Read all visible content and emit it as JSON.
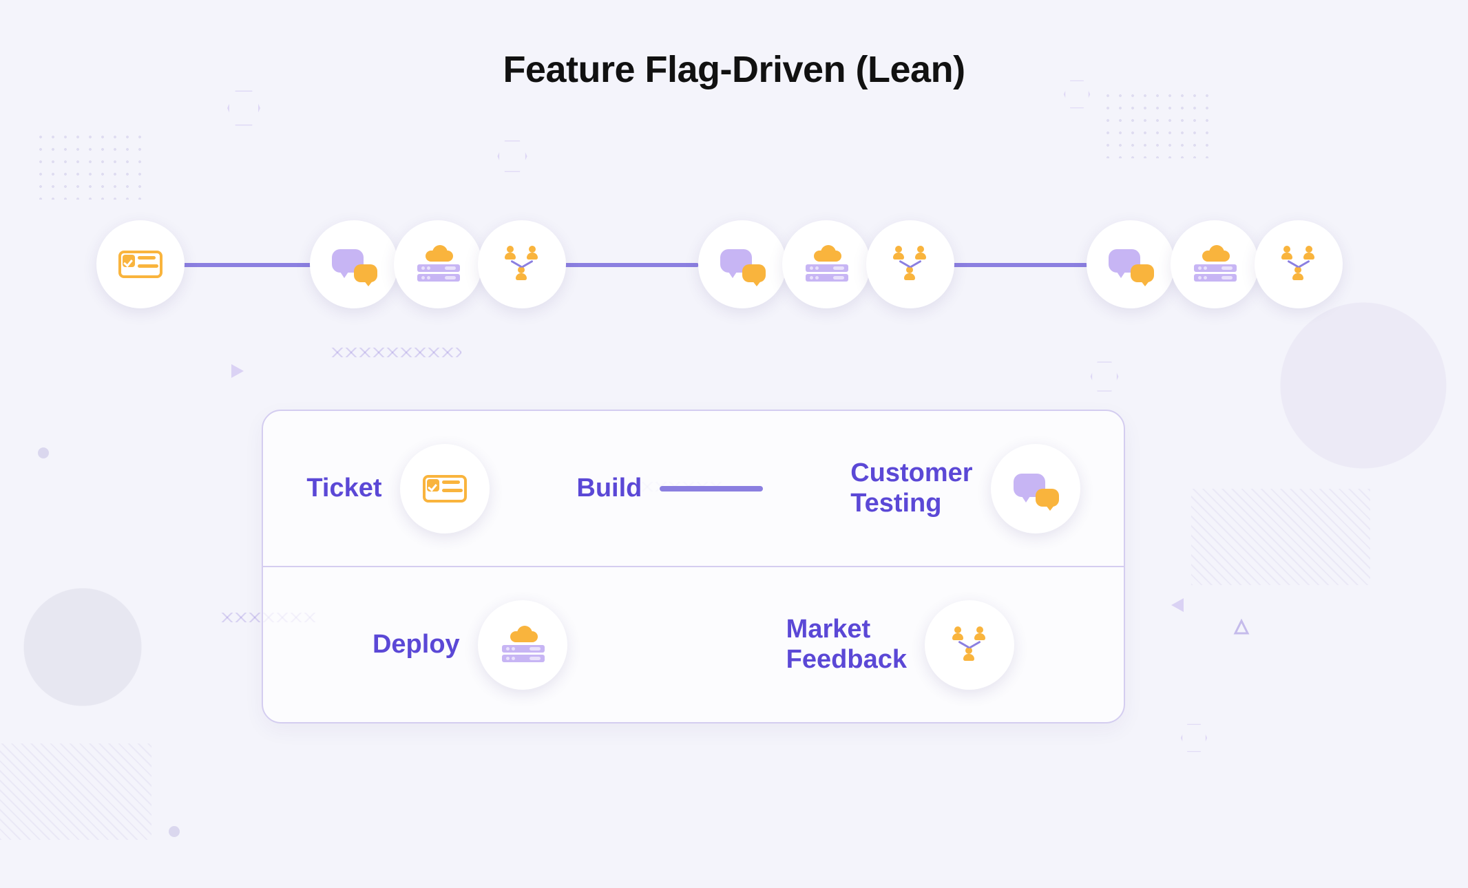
{
  "title": "Feature Flag-Driven (Lean)",
  "flow": {
    "start": {
      "icon": "ticket"
    },
    "groups": [
      {
        "steps": [
          {
            "icon": "chat"
          },
          {
            "icon": "deploy"
          },
          {
            "icon": "market"
          }
        ]
      },
      {
        "steps": [
          {
            "icon": "chat"
          },
          {
            "icon": "deploy"
          },
          {
            "icon": "market"
          }
        ]
      },
      {
        "steps": [
          {
            "icon": "chat"
          },
          {
            "icon": "deploy"
          },
          {
            "icon": "market"
          }
        ]
      }
    ]
  },
  "legend": {
    "row1": [
      {
        "label": "Ticket",
        "icon": "ticket"
      },
      {
        "label": "Build",
        "icon": "line"
      },
      {
        "label": "Customer\nTesting",
        "icon": "chat"
      }
    ],
    "row2": [
      {
        "label": "Deploy",
        "icon": "deploy"
      },
      {
        "label": "Market\nFeedback",
        "icon": "market"
      }
    ]
  },
  "colors": {
    "orange": "#f9b43d",
    "purple": "#c7b5f4",
    "line": "#8b7fe0",
    "text": "#5b48d6"
  }
}
